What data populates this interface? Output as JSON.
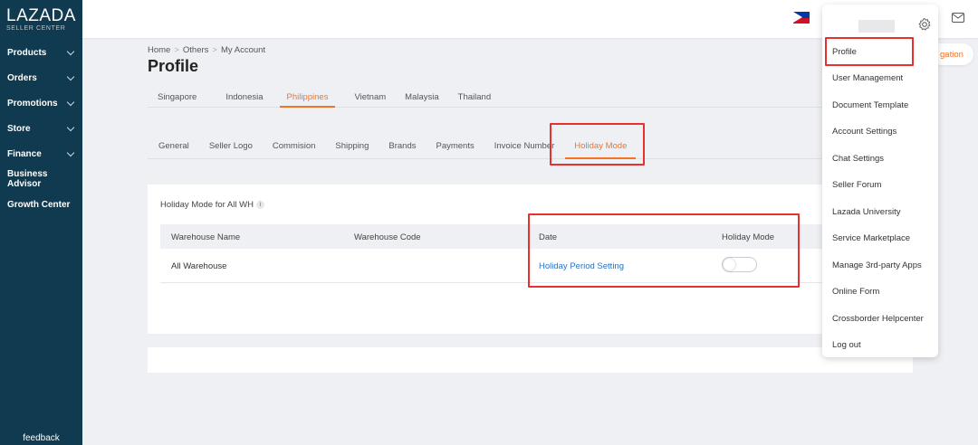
{
  "app": {
    "logo_line1": "LAZADA",
    "logo_line2": "SELLER CENTER",
    "accent": "#f57224",
    "sidebar_bg": "#0f3a4f"
  },
  "sidebar": {
    "items": [
      {
        "label": "Products",
        "has_chevron": true
      },
      {
        "label": "Orders",
        "has_chevron": true
      },
      {
        "label": "Promotions",
        "has_chevron": true
      },
      {
        "label": "Store",
        "has_chevron": true
      },
      {
        "label": "Finance",
        "has_chevron": true
      },
      {
        "label": "Business Advisor",
        "has_chevron": false
      },
      {
        "label": "Growth Center",
        "has_chevron": false
      }
    ],
    "feedback": "feedback"
  },
  "breadcrumb": [
    "Home",
    "Others",
    "My Account"
  ],
  "page_title": "Profile",
  "country_tabs": [
    "Singapore",
    "Indonesia",
    "Philippines",
    "Vietnam",
    "Malaysia",
    "Thailand"
  ],
  "country_active": "Philippines",
  "sub_tabs": [
    "General",
    "Seller Logo",
    "Commision",
    "Shipping",
    "Brands",
    "Payments",
    "Invoice Number",
    "Holiday Mode"
  ],
  "sub_active": "Holiday Mode",
  "holiday": {
    "title": "Holiday Mode for All WH",
    "info_icon": "i",
    "columns": [
      "Warehouse Name",
      "Warehouse Code",
      "Date",
      "Holiday Mode"
    ],
    "rows": [
      {
        "name": "All Warehouse",
        "code": "",
        "date_link": "Holiday Period Setting",
        "holiday_mode": false
      }
    ]
  },
  "partial_button": "gation",
  "dropdown": {
    "items": [
      "Profile",
      "User Management",
      "Document Template",
      "Account Settings",
      "Chat Settings",
      "Seller Forum",
      "Lazada University",
      "Service Marketplace",
      "Manage 3rd-party Apps",
      "Online Form",
      "Crossborder Helpcenter",
      "Log out"
    ]
  },
  "icons": {
    "flag": "philippines-flag-icon",
    "mail": "mail-icon",
    "gear": "gear-icon",
    "chevron": "chevron-down-icon"
  },
  "highlight_color": "#e8312e"
}
